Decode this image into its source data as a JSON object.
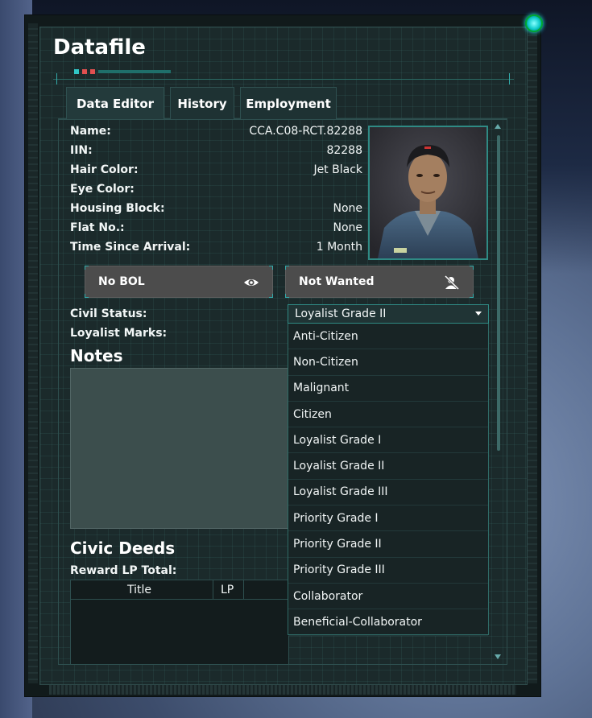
{
  "window": {
    "title": "Datafile"
  },
  "tabs": [
    {
      "label": "Data Editor",
      "active": true
    },
    {
      "label": "History",
      "active": false
    },
    {
      "label": "Employment",
      "active": false
    }
  ],
  "profile": {
    "fields": [
      {
        "label": "Name:",
        "value": "CCA.C08-RCT.82288"
      },
      {
        "label": "IIN:",
        "value": "82288"
      },
      {
        "label": "Hair Color:",
        "value": "Jet Black"
      },
      {
        "label": "Eye Color:",
        "value": ""
      },
      {
        "label": "Housing Block:",
        "value": "None"
      },
      {
        "label": "Flat No.:",
        "value": "None"
      },
      {
        "label": "Time Since Arrival:",
        "value": "1 Month"
      }
    ]
  },
  "status_buttons": {
    "bol": {
      "label": "No BOL",
      "icon": "eye-icon"
    },
    "wanted": {
      "label": "Not Wanted",
      "icon": "person-slash-icon"
    }
  },
  "civil_status": {
    "label": "Civil Status:",
    "selected": "Loyalist Grade II",
    "options": [
      "Anti-Citizen",
      "Non-Citizen",
      "Malignant",
      "Citizen",
      "Loyalist Grade I",
      "Loyalist Grade II",
      "Loyalist Grade III",
      "Priority Grade I",
      "Priority Grade II",
      "Priority Grade III",
      "Collaborator",
      "Beneficial-Collaborator"
    ]
  },
  "loyalist_marks": {
    "label": "Loyalist Marks:"
  },
  "notes": {
    "title": "Notes"
  },
  "civic_deeds": {
    "title": "Civic Deeds",
    "reward_label": "Reward LP Total:",
    "columns": [
      "Title",
      "LP"
    ]
  },
  "colors": {
    "accent": "#2f8a84",
    "panel_bg": "#1b2a2b",
    "button_bg": "#4c4c4c",
    "deco_cyan": "#31c6c6",
    "deco_red": "#e05050"
  }
}
